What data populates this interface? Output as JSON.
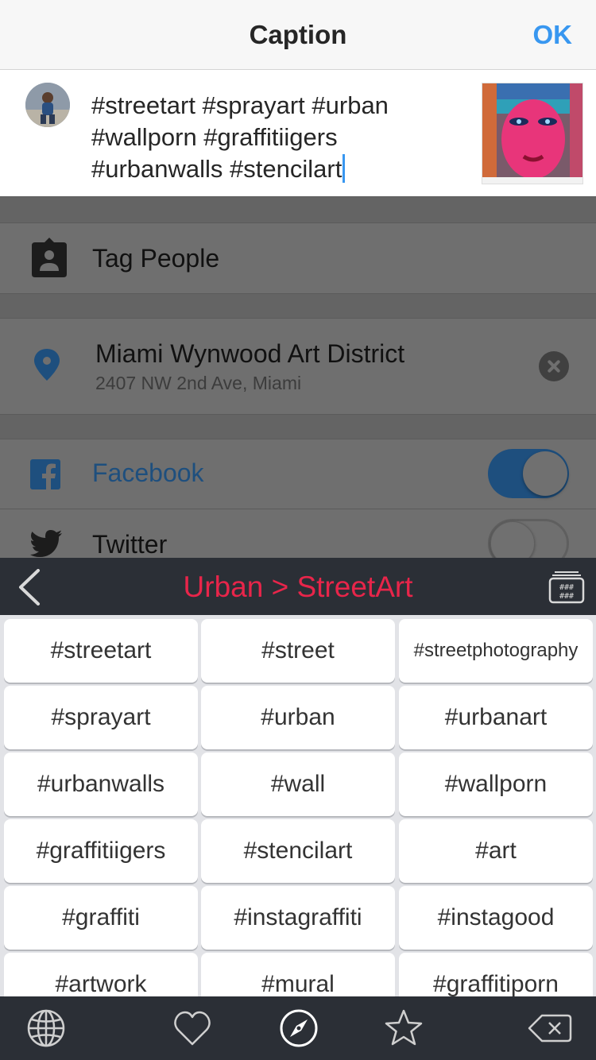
{
  "header": {
    "title": "Caption",
    "ok_label": "OK"
  },
  "caption": {
    "lines": [
      "#streetart #sprayart #urban",
      "#wallporn #graffitiigers",
      "#urbanwalls #stencilart"
    ]
  },
  "tag_people": {
    "label": "Tag People"
  },
  "location": {
    "name": "Miami Wynwood Art District",
    "address": "2407 NW 2nd Ave, Miami"
  },
  "share": {
    "facebook": {
      "label": "Facebook",
      "enabled": true
    },
    "twitter": {
      "label": "Twitter",
      "enabled": false
    }
  },
  "keyboard": {
    "path": "Urban > StreetArt",
    "tags": [
      "#streetart",
      "#street",
      "#streetphotography",
      "#sprayart",
      "#urban",
      "#urbanart",
      "#urbanwalls",
      "#wall",
      "#wallporn",
      "#graffitiigers",
      "#stencilart",
      "#art",
      "#graffiti",
      "#instagraffiti",
      "#instagood",
      "#artwork",
      "#mural",
      "#graffitiporn"
    ]
  },
  "toolbar": {
    "icons": [
      "globe-icon",
      "heart-icon",
      "compass-icon",
      "star-icon",
      "backspace-icon"
    ]
  },
  "colors": {
    "accent_blue": "#3897f0",
    "path_red": "#e8254a",
    "facebook_blue": "#1e4f7e",
    "keyboard_dark": "#2b2f36"
  }
}
